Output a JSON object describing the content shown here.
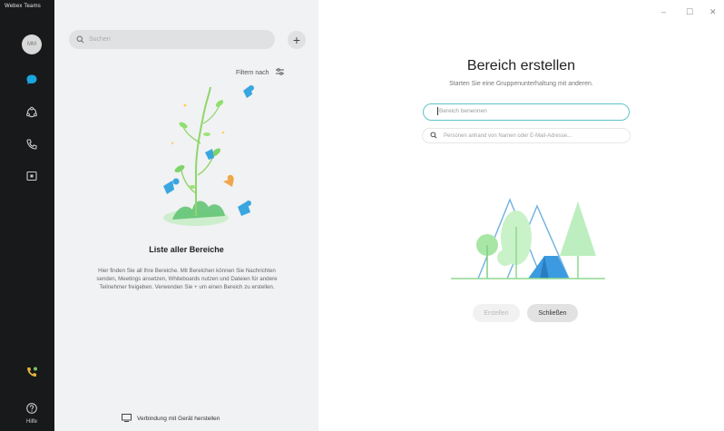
{
  "app": {
    "title": "Webex Teams"
  },
  "nav": {
    "avatar_initials": "MM",
    "help_label": "Hilfe"
  },
  "spaces_panel": {
    "search_placeholder": "Suchen",
    "filter_label": "Filtern nach",
    "empty_title": "Liste aller Bereiche",
    "empty_description": "Hier finden Sie all Ihre Bereiche. Mit Bereichen können Sie Nachrichten senden, Meetings ansetzen, Whiteboards nutzen und Dateien für andere Teilnehmer freigeben. Verwenden Sie + um einen Bereich zu erstellen.",
    "connect_device_label": "Verbindung mit Gerät herstellen"
  },
  "create_space": {
    "title": "Bereich erstellen",
    "subtitle": "Starten Sie eine Gruppenunterhaltung mit anderen.",
    "name_placeholder": "Bereich benennen",
    "people_placeholder": "Personen anhand von Namen oder E-Mail-Adresse...",
    "create_button": "Erstellen",
    "close_button": "Schließen"
  },
  "window_controls": {
    "minimize": "–",
    "maximize": "☐",
    "close": "✕"
  },
  "colors": {
    "accent": "#4fc3c7",
    "rail": "#17191b",
    "panel": "#f1f2f3",
    "chat_blue": "#1ba5e0"
  },
  "icons": [
    "chat-icon",
    "team-icon",
    "phone-icon",
    "meeting-icon",
    "search-icon",
    "filter-icon",
    "plus-icon",
    "help-icon",
    "device-icon",
    "call-status-icon"
  ]
}
